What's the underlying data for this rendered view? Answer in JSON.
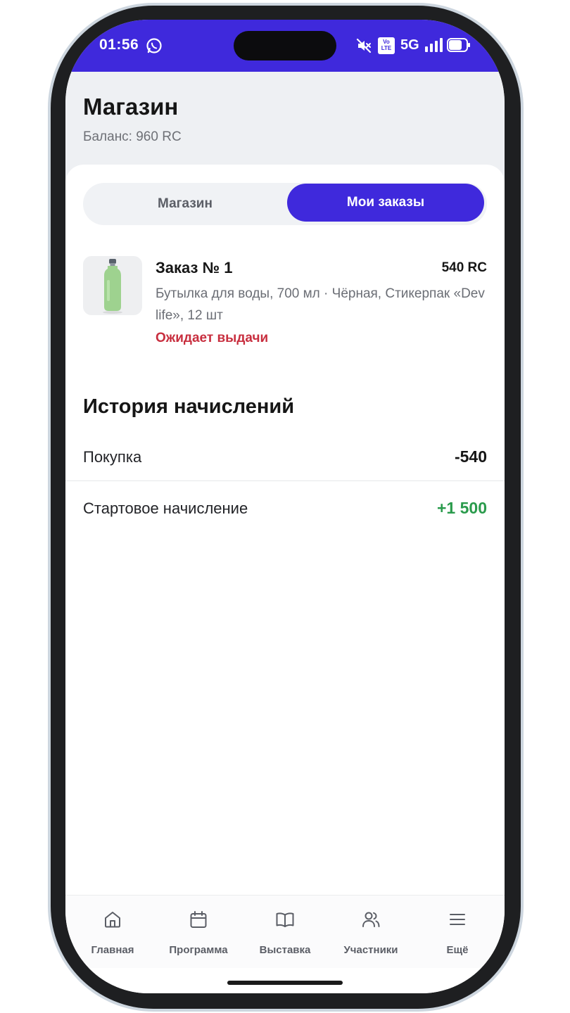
{
  "status_bar": {
    "time": "01:56",
    "network": "5G",
    "volte_top": "Vo",
    "volte_bottom": "LTE",
    "accent_color": "#3f29dc"
  },
  "header": {
    "title": "Магазин",
    "balance": "Баланс: 960 RC"
  },
  "tabs": [
    {
      "label": "Магазин",
      "active": false
    },
    {
      "label": "Мои заказы",
      "active": true
    }
  ],
  "order": {
    "title": "Заказ № 1",
    "price": "540 RC",
    "description": "Бутылка для воды, 700 мл · Чёрная, Стикерпак «Dev life», 12 шт",
    "status": "Ожидает выдачи",
    "status_color": "#c82f3f",
    "image": "green-water-bottle"
  },
  "history": {
    "title": "История начислений",
    "rows": [
      {
        "label": "Покупка",
        "amount": "-540",
        "color": "#161616"
      },
      {
        "label": "Стартовое начисление",
        "amount": "+1 500",
        "color": "#2a9b4c"
      }
    ]
  },
  "nav": {
    "items": [
      {
        "label": "Главная",
        "icon": "home-icon"
      },
      {
        "label": "Программа",
        "icon": "calendar-icon"
      },
      {
        "label": "Выставка",
        "icon": "book-icon"
      },
      {
        "label": "Участники",
        "icon": "users-icon"
      },
      {
        "label": "Ещё",
        "icon": "menu-icon"
      }
    ]
  }
}
